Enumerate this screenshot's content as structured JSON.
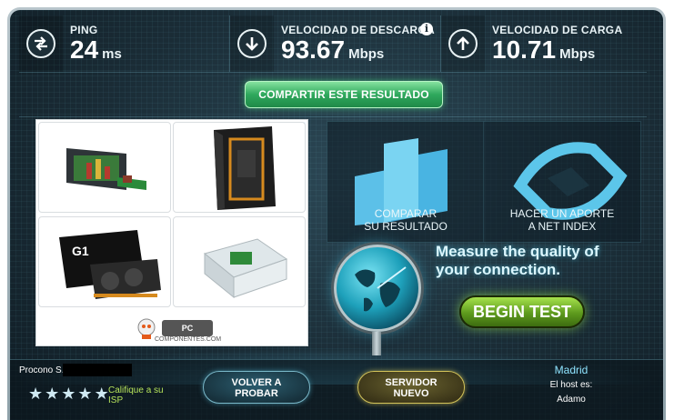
{
  "stats": {
    "ping_label": "PING",
    "ping_value": "24",
    "ping_unit": "ms",
    "download_label": "VELOCIDAD DE DESCARGA",
    "download_value": "93.67",
    "download_unit": "Mbps",
    "upload_label": "VELOCIDAD DE CARGA",
    "upload_value": "10.71",
    "upload_unit": "Mbps",
    "info_glyph": "i"
  },
  "share": {
    "label": "COMPARTIR ESTE RESULTADO"
  },
  "ad": {
    "close_glyphs": [
      "▷",
      "✕"
    ],
    "logo_text": "PC",
    "logo_caption": "COMPONENTES.COM"
  },
  "panels": {
    "compare_line1": "COMPARAR",
    "compare_line2": "SU RESULTADO",
    "donate_line1": "HACER UN APORTE",
    "donate_line2": "A NET INDEX"
  },
  "promo": {
    "measure_line1": "Measure the quality of",
    "measure_line2": "your connection.",
    "begin_label": "BEGIN TEST"
  },
  "bottom": {
    "isp_name": "Procono S.A.",
    "rate_line1": "Califique a su",
    "rate_line2": "ISP",
    "retry_line1": "VOLVER A",
    "retry_line2": "PROBAR",
    "server_line1": "SERVIDOR",
    "server_line2": "NUEVO",
    "server_city": "Madrid",
    "host_label": "El host es:",
    "host_value": "Adamo"
  },
  "colors": {
    "accent_green": "#2fa85d",
    "begin_green": "#5d9a1d",
    "cyan": "#8fe4ff"
  }
}
